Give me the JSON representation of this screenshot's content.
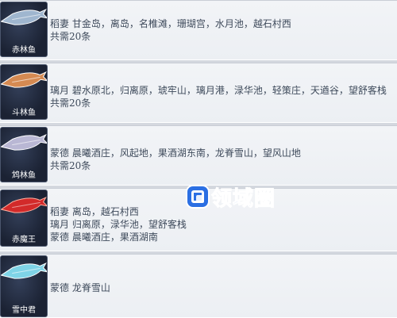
{
  "colors": {
    "fish1": "#9fb6cf",
    "fish2": "#d58a52",
    "fish3": "#b9b7d4",
    "fish4": "#d22a2a",
    "fish5": "#7fd4e7",
    "watermark": "#2e73e6"
  },
  "rows": [
    {
      "name": "赤林鱼",
      "lines": [
        "稻妻 甘金岛，离岛，名椎滩，珊瑚宫，水月池，越石村西",
        "共需20条"
      ]
    },
    {
      "name": "斗林鱼",
      "lines": [
        "璃月 碧水原北，归离原，琥牢山，璃月港，渌华池，轻策庄，天遒谷，望舒客栈",
        "共需20条"
      ]
    },
    {
      "name": "鸩林鱼",
      "lines": [
        "蒙德 晨曦酒庄，风起地，果酒湖东南，龙脊雪山，望风山地",
        "共需20条"
      ]
    },
    {
      "name": "赤魔王",
      "lines": [
        "稻妻 离岛，越石村西",
        "璃月 归离原，渌华池，望舒客栈",
        "蒙德 晨曦酒庄，果酒湖南"
      ]
    },
    {
      "name": "雪中君",
      "lines": [
        "蒙德 龙脊雪山"
      ]
    }
  ],
  "watermark": {
    "icon": "logo-square-icon",
    "text": "领域圈"
  }
}
